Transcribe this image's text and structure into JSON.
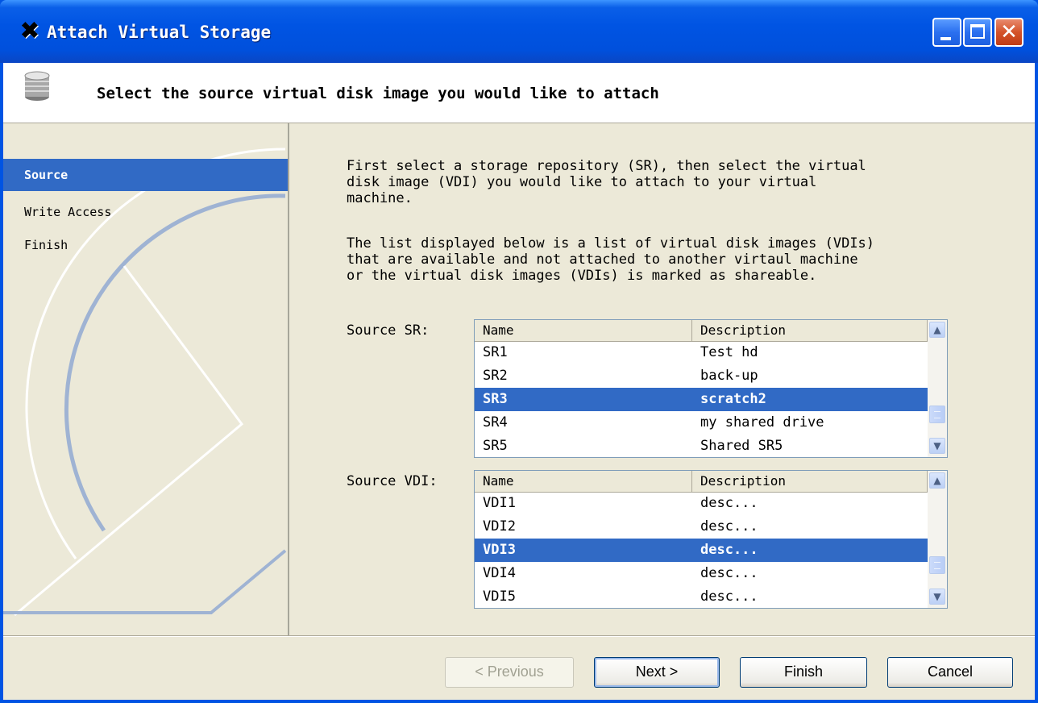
{
  "window": {
    "title": "Attach Virtual Storage",
    "app_icon": "x-logo-icon"
  },
  "header": {
    "icon": "disk-stack-icon",
    "text": "Select the source virtual disk image you would like to attach"
  },
  "steps": [
    {
      "label": "Source",
      "active": true
    },
    {
      "label": "Write Access",
      "active": false
    },
    {
      "label": "Finish",
      "active": false
    }
  ],
  "main": {
    "intro": "First select a storage repository (SR), then select the virtual\ndisk image (VDI) you would like to attach to your virtual\nmachine.",
    "list_note": "The list displayed below is a list of virtual disk images (VDIs)\nthat are available and not attached to another virtaul machine\nor the virtual disk images (VDIs) is marked as shareable."
  },
  "source_sr": {
    "label": "Source SR:",
    "columns": [
      "Name",
      "Description"
    ],
    "rows": [
      {
        "name": "SR1",
        "description": "Test hd"
      },
      {
        "name": "SR2",
        "description": "back-up"
      },
      {
        "name": "SR3",
        "description": "scratch2",
        "selected": true
      },
      {
        "name": "SR4",
        "description": "my shared drive"
      },
      {
        "name": "SR5",
        "description": "Shared SR5"
      }
    ]
  },
  "source_vdi": {
    "label": "Source VDI:",
    "columns": [
      "Name",
      "Description"
    ],
    "rows": [
      {
        "name": "VDI1",
        "description": "desc..."
      },
      {
        "name": "VDI2",
        "description": "desc..."
      },
      {
        "name": "VDI3",
        "description": "desc...",
        "selected": true
      },
      {
        "name": "VDI4",
        "description": "desc..."
      },
      {
        "name": "VDI5",
        "description": "desc..."
      }
    ]
  },
  "buttons": {
    "previous": "< Previous",
    "next": "Next >",
    "finish": "Finish",
    "cancel": "Cancel"
  },
  "colors": {
    "titlebar": "#0054e3",
    "selection": "#316ac5",
    "dialog_bg": "#ece9d8"
  }
}
